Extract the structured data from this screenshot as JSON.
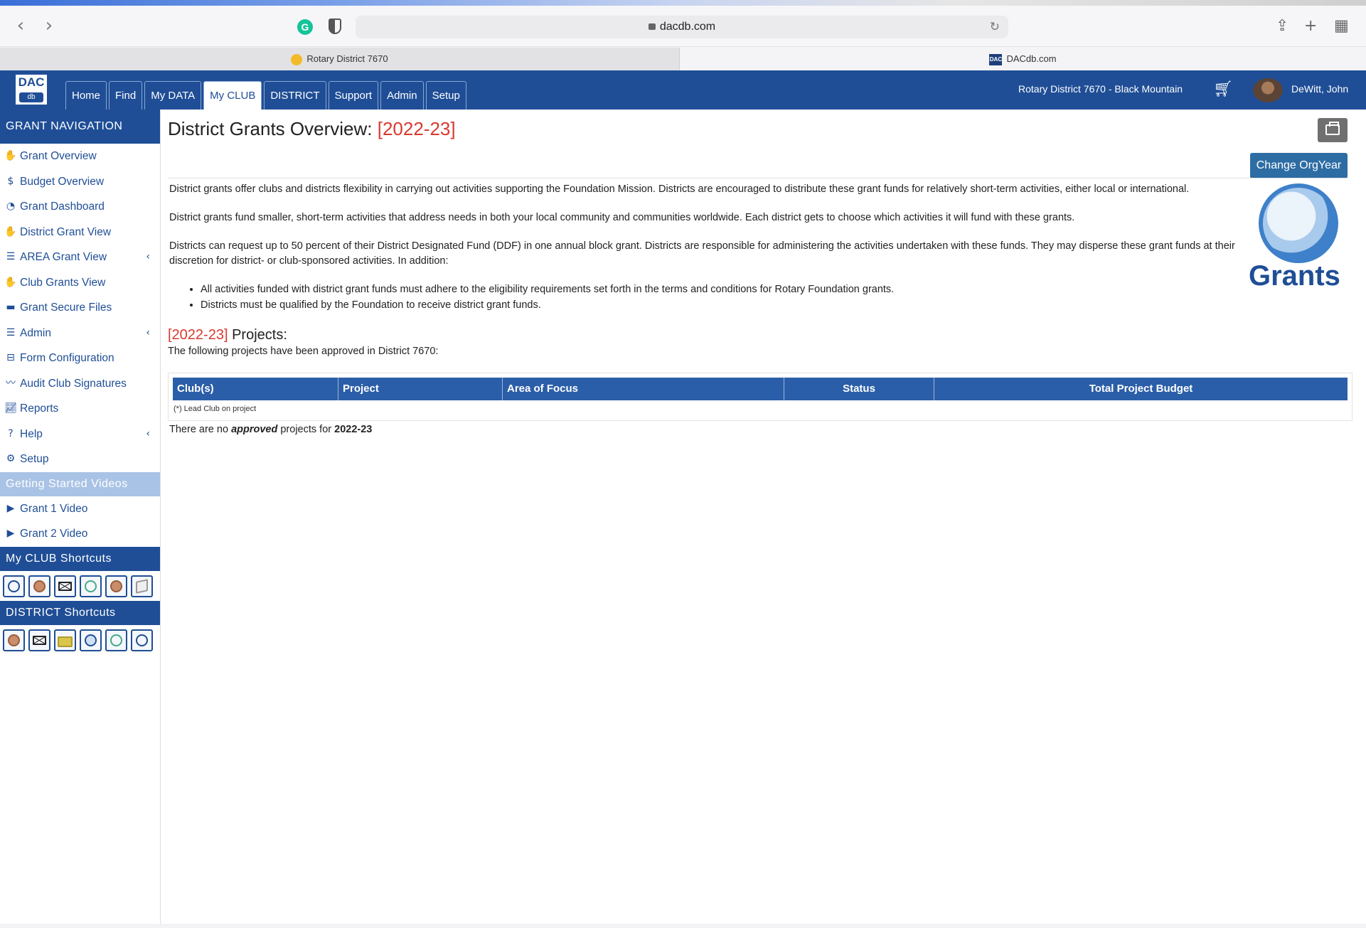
{
  "browser": {
    "url": "dacdb.com",
    "tabs": [
      {
        "label": "Rotary District 7670"
      },
      {
        "label": "DACdb.com"
      }
    ]
  },
  "header": {
    "logo_top": "DAC",
    "logo_bottom": "db",
    "nav": [
      "Home",
      "Find",
      "My DATA",
      "My CLUB",
      "DISTRICT",
      "Support",
      "Admin",
      "Setup"
    ],
    "active_nav": "My CLUB",
    "club_name": "Rotary District 7670 - Black Mountain",
    "user_name": "DeWitt, John"
  },
  "sidebar": {
    "grant_nav_title": "GRANT NAVIGATION",
    "items": [
      {
        "label": "Grant Overview",
        "icon": "hand-coin-icon"
      },
      {
        "label": "Budget Overview",
        "icon": "dollar-icon"
      },
      {
        "label": "Grant Dashboard",
        "icon": "dashboard-icon"
      },
      {
        "label": "District Grant View",
        "icon": "hand-coin-icon"
      },
      {
        "label": "AREA Grant View",
        "icon": "list-icon"
      },
      {
        "label": "Club Grants View",
        "icon": "hand-coin-icon"
      },
      {
        "label": "Grant Secure Files",
        "icon": "folder-icon"
      },
      {
        "label": "Admin",
        "icon": "list-icon"
      },
      {
        "label": "Form Configuration",
        "icon": "toolbox-icon"
      },
      {
        "label": "Audit Club Signatures",
        "icon": "signature-icon"
      },
      {
        "label": "Reports",
        "icon": "chart-icon"
      },
      {
        "label": "Help",
        "icon": "question-icon"
      },
      {
        "label": "Setup",
        "icon": "gears-icon"
      }
    ],
    "videos_title": "Getting Started Videos",
    "videos": [
      {
        "label": "Grant 1 Video"
      },
      {
        "label": "Grant 2 Video"
      }
    ],
    "club_shortcuts_title": "My CLUB Shortcuts",
    "district_shortcuts_title": "DISTRICT Shortcuts"
  },
  "main": {
    "title": "District Grants Overview:",
    "title_year": "[2022-23]",
    "change_button": "Change OrgYear",
    "para1": "District grants offer clubs and districts flexibility in carrying out activities supporting the Foundation Mission. Districts are encouraged to distribute these grant funds for relatively short-term activities, either local or international.",
    "para2": "District grants fund smaller, short-term activities that address needs in both your local community and communities worldwide. Each district gets to choose which activities it will fund with these grants.",
    "para3": "Districts can request up to 50 percent of their District Designated Fund (DDF) in one annual block grant. Districts are responsible for administering the activities undertaken with these funds. They may disperse these grant funds at their discretion for district- or club-sponsored activities. In addition:",
    "bullets": [
      "All activities funded with district grant funds must adhere to the eligibility requirements set forth in the terms and conditions for Rotary Foundation grants.",
      "Districts must be qualified by the Foundation to receive district grant funds."
    ],
    "grants_logo_text": "Grants",
    "projects_year": "[2022-23]",
    "projects_title": "Projects:",
    "projects_sub": "The following projects have been approved in District 7670:",
    "table_headers": [
      "Club(s)",
      "Project",
      "Area of Focus",
      "Status",
      "Total Project Budget"
    ],
    "lead_note": "(*) Lead Club on project",
    "no_proj_prefix": "There are no",
    "no_proj_bold": "approved",
    "no_proj_mid": "projects for",
    "no_proj_year": "2022-23"
  },
  "colors": {
    "brand": "#1f4e96",
    "accent_red": "#d9392f",
    "button": "#2e6da4"
  }
}
